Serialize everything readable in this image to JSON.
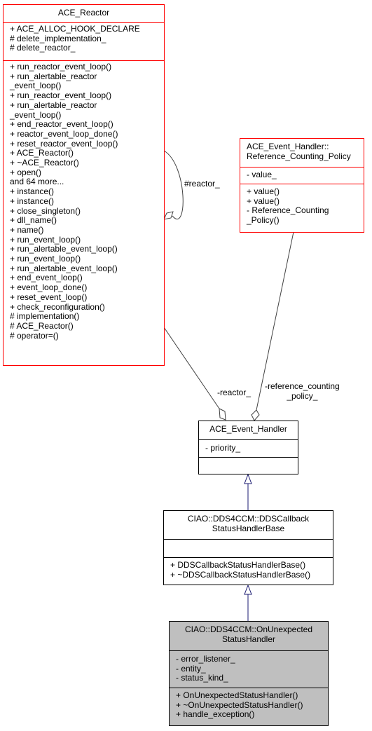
{
  "classes": {
    "ace_reactor": {
      "title": "ACE_Reactor",
      "attributes": [
        "+ ACE_ALLOC_HOOK_DECLARE",
        "# delete_implementation_",
        "# delete_reactor_"
      ],
      "operations": [
        "+ run_reactor_event_loop()",
        "+ run_alertable_reactor",
        "_event_loop()",
        "+ run_reactor_event_loop()",
        "+ run_alertable_reactor",
        "_event_loop()",
        "+ end_reactor_event_loop()",
        "+ reactor_event_loop_done()",
        "+ reset_reactor_event_loop()",
        "+ ACE_Reactor()",
        "+ ~ACE_Reactor()",
        "+ open()",
        "and 64 more...",
        "+ instance()",
        "+ instance()",
        "+ close_singleton()",
        "+ dll_name()",
        "+ name()",
        "+ run_event_loop()",
        "+ run_alertable_event_loop()",
        "+ run_event_loop()",
        "+ run_alertable_event_loop()",
        "+ end_event_loop()",
        "+ event_loop_done()",
        "+ reset_event_loop()",
        "+ check_reconfiguration()",
        "# implementation()",
        "# ACE_Reactor()",
        "# operator=()"
      ]
    },
    "reference_counting_policy": {
      "title_lines": [
        "ACE_Event_Handler::",
        "Reference_Counting_Policy"
      ],
      "attributes": [
        "- value_"
      ],
      "operations": [
        "+ value()",
        "+ value()",
        "- Reference_Counting",
        "_Policy()"
      ]
    },
    "ace_event_handler": {
      "title": "ACE_Event_Handler",
      "attributes": [
        "- priority_"
      ],
      "operations": []
    },
    "dds_callback_status_handler_base": {
      "title_lines": [
        "CIAO::DDS4CCM::DDSCallback",
        "StatusHandlerBase"
      ],
      "attributes": [],
      "operations": [
        "+ DDSCallbackStatusHandlerBase()",
        "+ ~DDSCallbackStatusHandlerBase()"
      ]
    },
    "on_unexpected_status_handler": {
      "title_lines": [
        "CIAO::DDS4CCM::OnUnexpected",
        "StatusHandler"
      ],
      "attributes": [
        "- error_listener_",
        "- entity_",
        "- status_kind_"
      ],
      "operations": [
        "+ OnUnexpectedStatusHandler()",
        "+ ~OnUnexpectedStatusHandler()",
        "+ handle_exception()"
      ]
    }
  },
  "edge_labels": {
    "self_reactor": "#reactor_",
    "reactor": "-reactor_",
    "reference_counting_policy": [
      "-reference_counting",
      "_policy_"
    ]
  },
  "colors": {
    "highlight_border": "#ff0000",
    "normal_border": "#000000",
    "focus_fill": "#bfbfbf",
    "inheritance_edge": "#191970",
    "aggregation_edge": "#404040"
  }
}
